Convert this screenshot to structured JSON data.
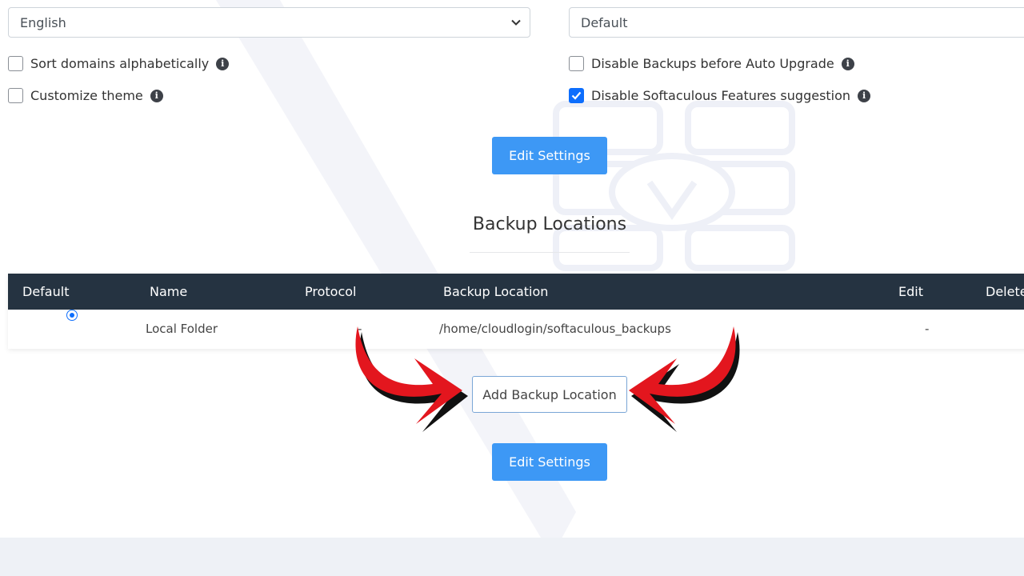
{
  "settings": {
    "language_select": {
      "value": "English"
    },
    "theme_select": {
      "value": "Default"
    },
    "checkboxes": {
      "sort_domains": {
        "label": "Sort domains alphabetically",
        "checked": false
      },
      "customize_theme": {
        "label": "Customize theme",
        "checked": false
      },
      "disable_backups": {
        "label": "Disable Backups before Auto Upgrade",
        "checked": false
      },
      "disable_suggestions": {
        "label": "Disable Softaculous Features suggestion",
        "checked": true
      }
    },
    "edit_button_label": "Edit Settings"
  },
  "backup_locations": {
    "title": "Backup Locations",
    "columns": {
      "default": "Default",
      "name": "Name",
      "protocol": "Protocol",
      "location": "Backup Location",
      "edit": "Edit",
      "delete": "Delete"
    },
    "rows": [
      {
        "default_selected": true,
        "name": "Local Folder",
        "protocol": "-",
        "location": "/home/cloudlogin/softaculous_backups",
        "edit": "-"
      }
    ],
    "add_button_label": "Add Backup Location",
    "edit_button_label": "Edit Settings"
  },
  "icons": {
    "select_chevron": "chevron-down-icon",
    "info": "info-icon",
    "checkmark": "checkmark-icon"
  },
  "colors": {
    "primary_button": "#3d98f5",
    "table_header": "#253341",
    "checkbox_checked": "#0d6efd",
    "annotation_arrow": "#e3161e"
  }
}
